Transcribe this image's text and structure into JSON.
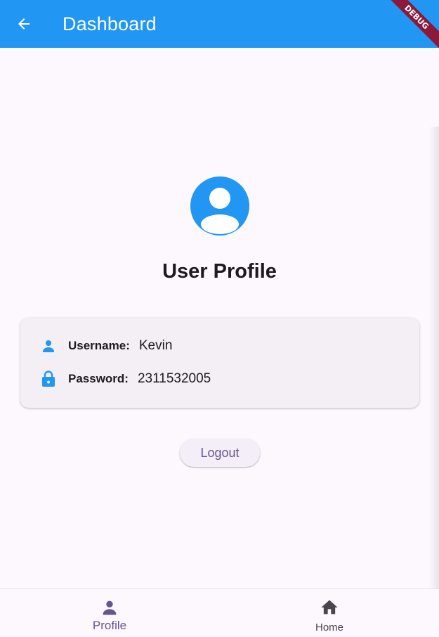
{
  "appbar": {
    "title": "Dashboard",
    "back_icon": "arrow-back-icon",
    "color": "#2196f3"
  },
  "debug_banner": {
    "label": "DEBUG"
  },
  "profile": {
    "avatar_icon": "account-circle-icon",
    "title": "User Profile"
  },
  "details": {
    "username": {
      "icon": "person-icon",
      "label": "Username:",
      "value": "Kevin"
    },
    "password": {
      "icon": "lock-icon",
      "label": "Password:",
      "value": "2311532005"
    }
  },
  "logout": {
    "label": "Logout"
  },
  "bottom_nav": {
    "items": [
      {
        "icon": "person-icon",
        "label": "Profile",
        "selected": true
      },
      {
        "icon": "home-icon",
        "label": "Home",
        "selected": false
      }
    ],
    "selected_color": "#65558f"
  }
}
